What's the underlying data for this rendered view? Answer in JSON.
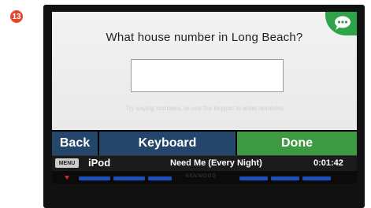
{
  "step_badge": "13",
  "prompt": {
    "question": "What house number in Long Beach?",
    "hint": "Try saying numbers, or use the keypad to enter numbers"
  },
  "input": {
    "value": ""
  },
  "buttons": {
    "back": "Back",
    "keyboard": "Keyboard",
    "done": "Done"
  },
  "status": {
    "menu": "MENU",
    "source": "iPod",
    "track": "Need Me (Every Night)",
    "time": "0:01:42"
  },
  "device": {
    "brand": "KENWOOD"
  },
  "colors": {
    "accent_green": "#3e9a42",
    "button_blue": "#23466a",
    "badge_red": "#e8452f"
  },
  "icons": {
    "voice": "speech-bubble-icon"
  }
}
